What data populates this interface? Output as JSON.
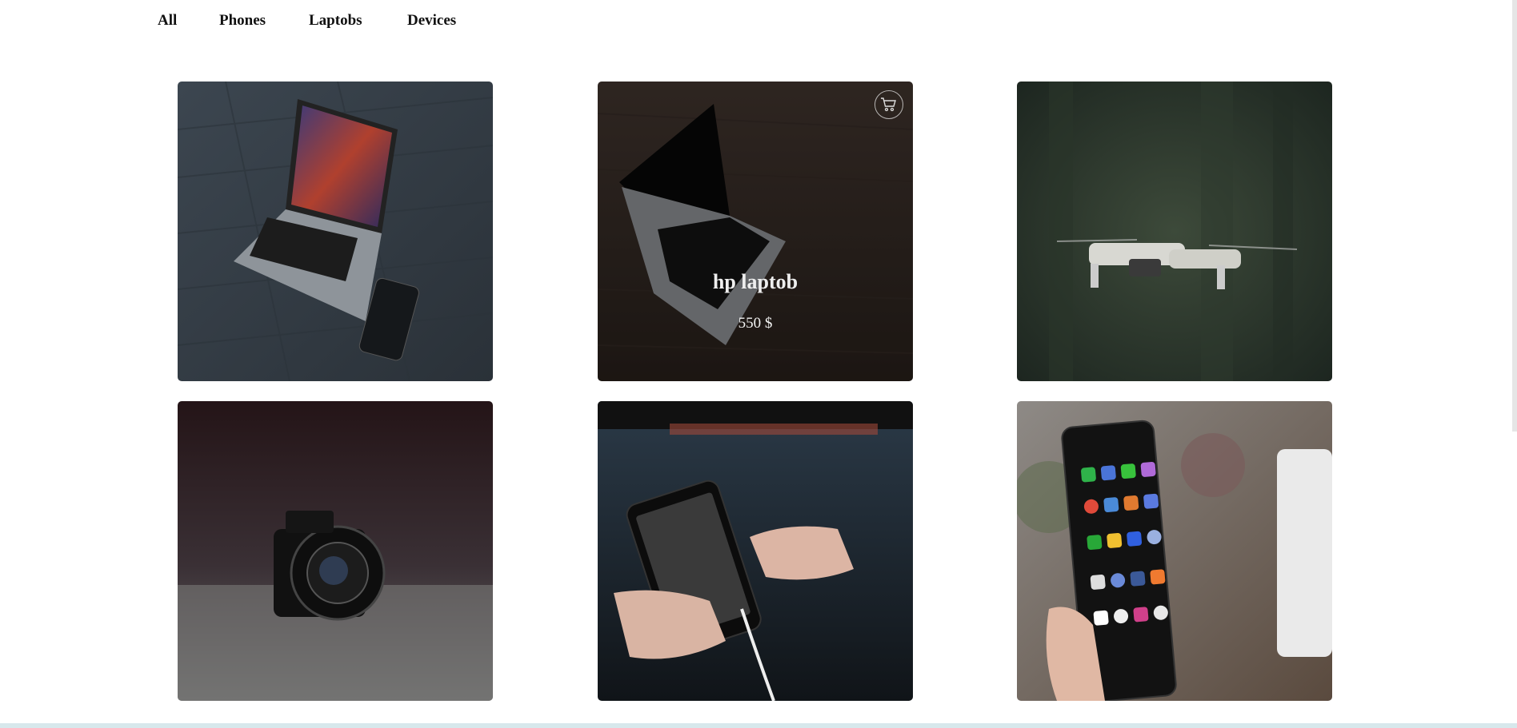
{
  "filters": {
    "all": "All",
    "phones": "Phones",
    "laptops": "Laptobs",
    "devices": "Devices"
  },
  "products": [
    {
      "image": "laptop-and-phone-on-wooden-floor"
    },
    {
      "image": "laptop-on-wooden-table",
      "title": "hp laptob",
      "price": "550 $",
      "icon": "cart-icon"
    },
    {
      "image": "drone-in-forest"
    },
    {
      "image": "canon-camera"
    },
    {
      "image": "hands-holding-phone"
    },
    {
      "image": "hand-holding-android-phone"
    }
  ],
  "colors": {
    "text": "#111111",
    "overlay_text": "#f2f2f2",
    "bottom_bar": "#d7e8ec"
  }
}
